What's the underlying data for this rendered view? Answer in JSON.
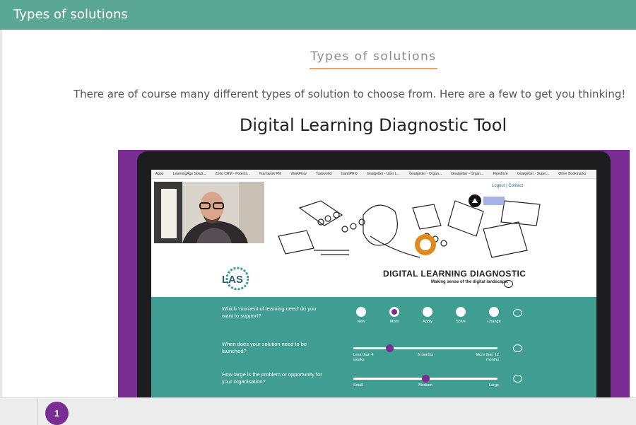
{
  "header": {
    "title": "Types of solutions"
  },
  "section": {
    "heading": "Types of solutions"
  },
  "intro": "There are of course many different types of solution to choose from. Here are a few to get you thinking!",
  "tool_title": "Digital Learning Diagnostic Tool",
  "video": {
    "bookmarks": [
      "Apps",
      "LearningAge Soluti...",
      "Zoho CRM - Potenti...",
      "Teamwork PM",
      "WorkFlow",
      "Taskworld",
      "GanttPRO",
      "Goalgetter - User L...",
      "Goalgetter - Organ...",
      "Goalgetter - Organ...",
      "Pipedrive",
      "Goalgetter - Super...",
      "Other Bookmarks"
    ],
    "nav": {
      "logout": "Logout",
      "separator": "|",
      "contact": "Contact"
    },
    "logo_text": "LAS",
    "page_heading": "DIGITAL LEARNING DIAGNOSTIC",
    "page_subheading": "Making sense of the digital landscape.",
    "q1": {
      "question": "Which 'moment of learning need' do you want to support?",
      "options": [
        "New",
        "More",
        "Apply",
        "Solve",
        "Change"
      ],
      "selected": "More"
    },
    "q2": {
      "question": "When does your solution need to be launched?",
      "labels": [
        "Less than 4 weeks",
        "6 months",
        "More than 12 months"
      ],
      "value_fraction": 0.25
    },
    "q3": {
      "question": "How large is the problem or opportunity for your organisation?",
      "labels": [
        "Small",
        "Medium",
        "Large"
      ],
      "value_fraction": 0.5
    },
    "colors": {
      "frame": "#7a2d92",
      "panel": "#409d91",
      "accent": "#7a2d92"
    }
  },
  "pager": {
    "current": "1"
  },
  "colors": {
    "topbar": "#5aa894",
    "underline": "#f0a35a",
    "badge": "#7a2d92"
  }
}
